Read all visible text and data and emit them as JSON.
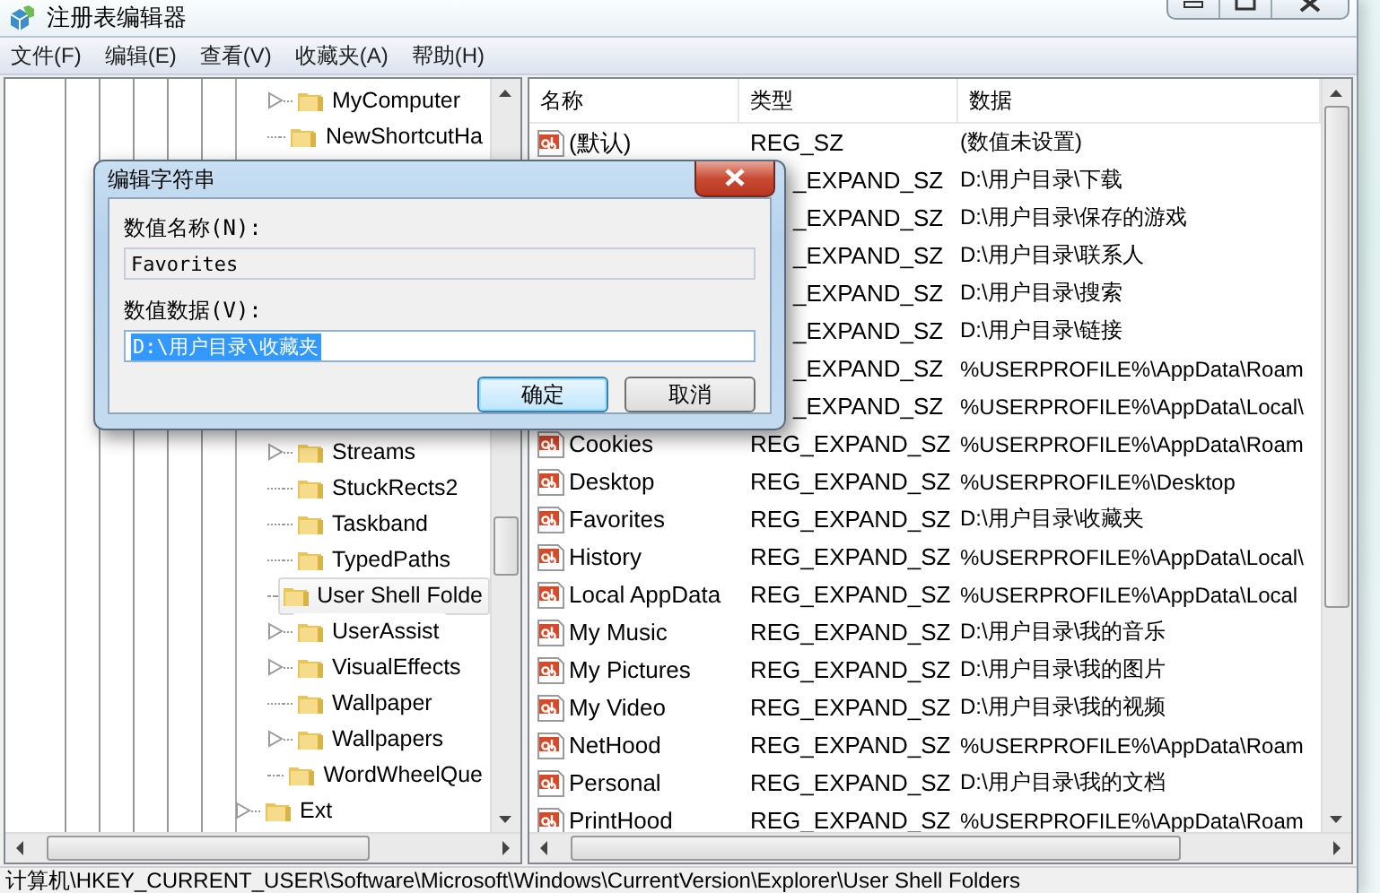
{
  "window": {
    "title": "注册表编辑器"
  },
  "menu": [
    "文件(F)",
    "编辑(E)",
    "查看(V)",
    "收藏夹(A)",
    "帮助(H)"
  ],
  "tree": [
    {
      "children": [
        {
          "label": "MyComputer",
          "expandable": true,
          "selected": false
        },
        {
          "label": "NewShortcutHa",
          "expandable": false,
          "selected": false
        },
        {
          "label": "Streams",
          "expandable": true,
          "selected": false
        },
        {
          "label": "StuckRects2",
          "expandable": false,
          "selected": false
        },
        {
          "label": "Taskband",
          "expandable": false,
          "selected": false
        },
        {
          "label": "TypedPaths",
          "expandable": false,
          "selected": false
        },
        {
          "label": "User Shell Folde",
          "expandable": false,
          "selected": true
        },
        {
          "label": "UserAssist",
          "expandable": true,
          "selected": false
        },
        {
          "label": "VisualEffects",
          "expandable": true,
          "selected": false
        },
        {
          "label": "Wallpaper",
          "expandable": false,
          "selected": false
        },
        {
          "label": "Wallpapers",
          "expandable": true,
          "selected": false
        },
        {
          "label": "WordWheelQue",
          "expandable": false,
          "selected": false
        }
      ]
    },
    {
      "label": "Ext",
      "expandable": true,
      "selected": false
    }
  ],
  "list": {
    "columns": [
      "名称",
      "类型",
      "数据"
    ],
    "rows": [
      {
        "name": "(默认)",
        "type": "REG_SZ",
        "data": "(数值未设置)"
      },
      {
        "type": "_EXPAND_SZ",
        "data": "D:\\用户目录\\下载"
      },
      {
        "type": "_EXPAND_SZ",
        "data": "D:\\用户目录\\保存的游戏"
      },
      {
        "type": "_EXPAND_SZ",
        "data": "D:\\用户目录\\联系人"
      },
      {
        "type": "_EXPAND_SZ",
        "data": "D:\\用户目录\\搜索"
      },
      {
        "type": "_EXPAND_SZ",
        "data": "D:\\用户目录\\链接"
      },
      {
        "type": "_EXPAND_SZ",
        "data": "%USERPROFILE%\\AppData\\Roam"
      },
      {
        "type": "_EXPAND_SZ",
        "data": "%USERPROFILE%\\AppData\\Local\\"
      },
      {
        "name": "Cookies",
        "type": "REG_EXPAND_SZ",
        "data": "%USERPROFILE%\\AppData\\Roam"
      },
      {
        "name": "Desktop",
        "type": "REG_EXPAND_SZ",
        "data": "%USERPROFILE%\\Desktop"
      },
      {
        "name": "Favorites",
        "type": "REG_EXPAND_SZ",
        "data": "D:\\用户目录\\收藏夹"
      },
      {
        "name": "History",
        "type": "REG_EXPAND_SZ",
        "data": "%USERPROFILE%\\AppData\\Local\\"
      },
      {
        "name": "Local AppData",
        "type": "REG_EXPAND_SZ",
        "data": "%USERPROFILE%\\AppData\\Local"
      },
      {
        "name": "My Music",
        "type": "REG_EXPAND_SZ",
        "data": "D:\\用户目录\\我的音乐"
      },
      {
        "name": "My Pictures",
        "type": "REG_EXPAND_SZ",
        "data": "D:\\用户目录\\我的图片"
      },
      {
        "name": "My Video",
        "type": "REG_EXPAND_SZ",
        "data": "D:\\用户目录\\我的视频"
      },
      {
        "name": "NetHood",
        "type": "REG_EXPAND_SZ",
        "data": "%USERPROFILE%\\AppData\\Roam"
      },
      {
        "name": "Personal",
        "type": "REG_EXPAND_SZ",
        "data": "D:\\用户目录\\我的文档"
      },
      {
        "name": "PrintHood",
        "type": "REG_EXPAND_SZ",
        "data": "%USERPROFILE%\\AppData\\Roam"
      }
    ]
  },
  "dialog": {
    "title": "编辑字符串",
    "name_label": "数值名称(N):",
    "name_value": "Favorites",
    "data_label": "数值数据(V):",
    "data_value": "D:\\用户目录\\收藏夹",
    "data_selected": true,
    "buttons": [
      {
        "label": "确定",
        "default": true
      },
      {
        "label": "取消",
        "default": false
      }
    ]
  },
  "status_bar": "计算机\\HKEY_CURRENT_USER\\Software\\Microsoft\\Windows\\CurrentVersion\\Explorer\\User Shell Folders"
}
